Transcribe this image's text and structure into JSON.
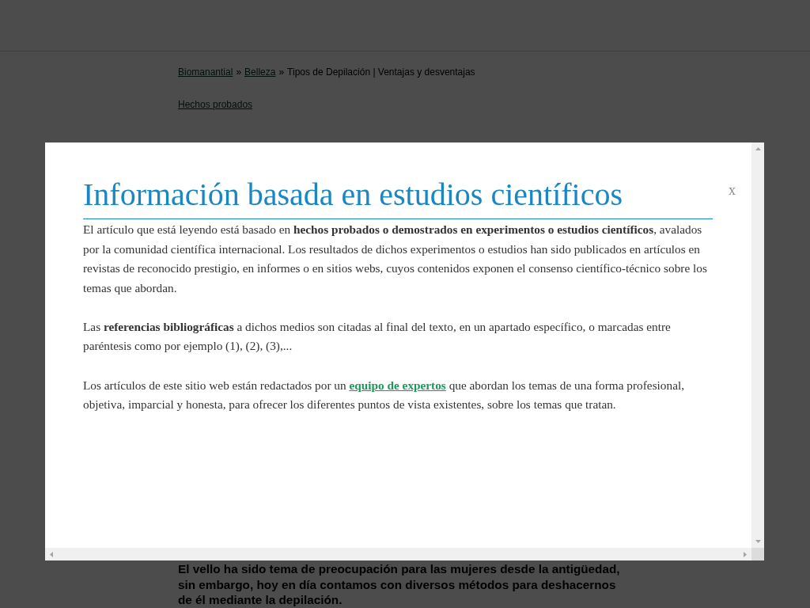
{
  "page": {
    "breadcrumb": [
      {
        "kind": "link",
        "text": "Biomanantial"
      },
      {
        "kind": "separator",
        "text": "»"
      },
      {
        "kind": "link",
        "text": "Belleza"
      },
      {
        "kind": "separator",
        "text": "»"
      },
      {
        "kind": "current",
        "text": "Tipos de Depilación | Ventajas y desventajas"
      }
    ],
    "facts_link": "Hechos probados",
    "intro": "El vello ha sido tema de preocupación para las mujeres desde la antigüedad, sin embargo, hoy en día contamos con diversos métodos para deshacernos de él mediante la depilación."
  },
  "modal": {
    "title": "Información basada en estudios científicos",
    "close": "x",
    "paragraphs": [
      [
        {
          "kind": "text",
          "text": "El artículo que está leyendo está basado en **hechos probados o demostrados en experimentos o estudios científicos**, avalados por la comunidad científica internacional. Los resultados de dichos experimentos o estudios han sido publicados en artículos en revistas de reconocido prestigio, en informes o en sitios webs, cuyos contenidos exponen el consenso científico-técnico sobre los temas que abordan."
        }
      ],
      [
        {
          "kind": "text",
          "text": "Las **referencias bibliográficas** a dichos medios son citadas al final del texto, en un apartado específico, o marcadas entre paréntesis como por ejemplo (1), (2), (3),..."
        }
      ],
      [
        {
          "kind": "text",
          "text": "Los artículos de este sitio web están redactados por un "
        },
        {
          "kind": "link",
          "text": "equipo de expertos"
        },
        {
          "kind": "text",
          "text": " que abordan los temas de una forma profesional, objetiva, imparcial y honesta, para ofrecer los diferentes puntos de vista existentes, sobre los temas que tratan."
        }
      ]
    ]
  }
}
